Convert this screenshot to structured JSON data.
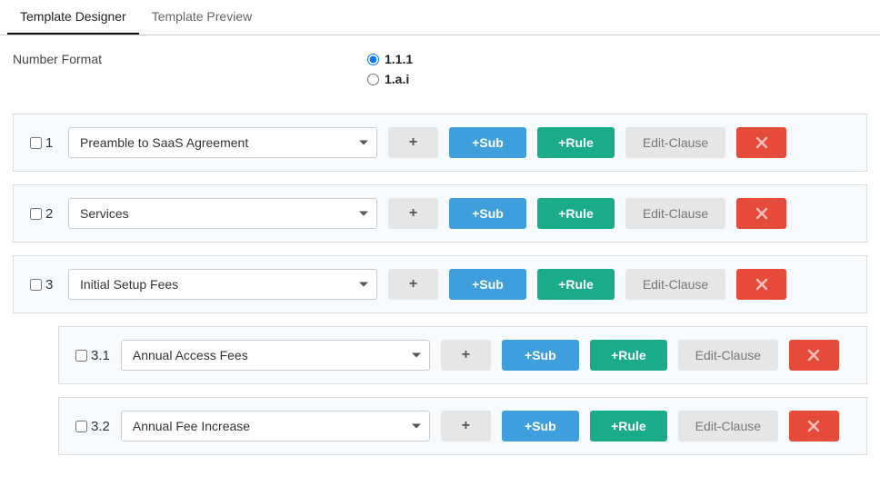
{
  "tabs": {
    "designer": "Template Designer",
    "preview": "Template Preview",
    "active": "designer"
  },
  "format": {
    "label": "Number Format",
    "opt1": "1.1.1",
    "opt2": "1.a.i",
    "selected": "opt1"
  },
  "btn": {
    "plus": "+",
    "sub": "+Sub",
    "rule": "+Rule",
    "edit": "Edit-Clause"
  },
  "clauses": [
    {
      "num": "1",
      "title": "Preamble to SaaS Agreement"
    },
    {
      "num": "2",
      "title": "Services"
    },
    {
      "num": "3",
      "title": "Initial Setup Fees"
    },
    {
      "num": "3.1",
      "title": "Annual Access Fees"
    },
    {
      "num": "3.2",
      "title": "Annual Fee Increase"
    }
  ]
}
